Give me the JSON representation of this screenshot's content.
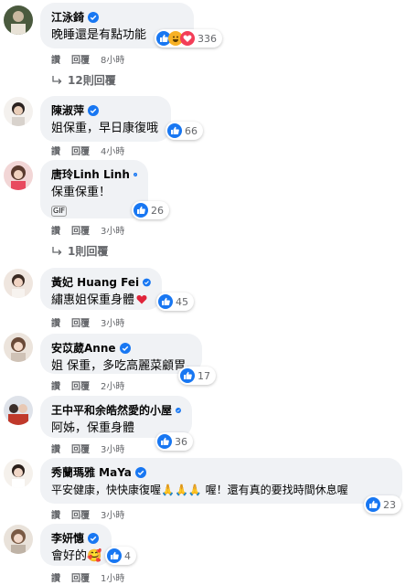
{
  "comments": [
    {
      "name": "江泳錡",
      "text": "晚睡還是有點功能",
      "reactions": "336",
      "actions": [
        "讚",
        "回覆",
        "8小時"
      ]
    },
    {
      "name": "陳淑萍",
      "text": "姐保重，早日康復哦",
      "reactions": "66",
      "actions": [
        "讚",
        "回覆",
        "4小時"
      ]
    },
    {
      "name": "唐玲Linh Linh",
      "text": "保重保重！",
      "sticker": "GIF",
      "reactions": "26",
      "actions": [
        "讚",
        "回覆",
        "3小時"
      ]
    },
    {
      "name": "黃妃 Huang Fei",
      "text": "繡惠姐保重身體",
      "reactions": "45",
      "actions": [
        "讚",
        "回覆",
        "3小時"
      ]
    },
    {
      "name": "安苡葳Anne",
      "text": "姐 保重，多吃高麗菜顧胃。",
      "reactions": "17",
      "actions": [
        "讚",
        "回覆",
        "2小時"
      ]
    },
    {
      "name": "王中平和余皓然愛的小屋",
      "text": "阿姊，保重身體",
      "reactions": "36",
      "actions": [
        "讚",
        "回覆",
        "3小時"
      ]
    },
    {
      "name": "秀蘭瑪雅 MaYa",
      "text": "平安健康，快快康復喔🙏🙏🙏 喔！還有真的要找時間休息喔",
      "reactions": "23",
      "actions": [
        "讚",
        "回覆",
        "3小時"
      ]
    },
    {
      "name": "李妍憓",
      "text": "會好的🥰",
      "reactions": "4",
      "actions": [
        "讚",
        "回覆",
        "1小時"
      ]
    }
  ],
  "reply_links": {
    "first": "12則回覆",
    "second": "1則回覆"
  },
  "colors": {
    "bubble": "#f0f2f5",
    "like": "#1877f2",
    "verified": "#1877f2",
    "heart": "#f33e58",
    "haha": "#f7b125",
    "meta": "#65676b"
  },
  "icons": {
    "like": "like-icon",
    "haha": "haha-icon",
    "love": "love-icon",
    "verified": "verified-badge-icon",
    "reply_arrow": "reply-arrow-icon"
  }
}
